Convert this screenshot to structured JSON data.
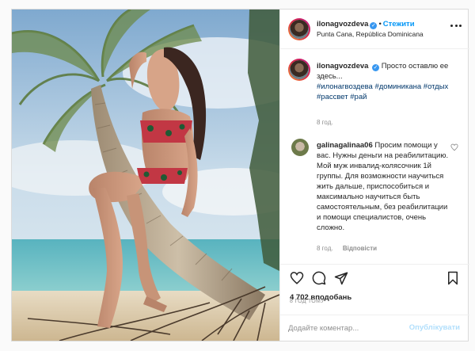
{
  "post": {
    "username": "ilonagvozdeva",
    "follow_label": "Стежити",
    "location": "Punta Cana, República Dominicana",
    "caption_text": "Просто оставлю ее здесь...",
    "hashtags": "#илонагвоздева #доминикана #отдых #рассвет #рай",
    "caption_time": "8 год.",
    "photo_alt": "woman in red floral bikini sitting on a palm tree trunk on a beach"
  },
  "comment": {
    "username": "galinagalinaa06",
    "text": "Просим помощи у вас. Нужны деньги на реабилитацию. Мой муж инвалид-колясочник 1й группы. Для возможности научиться жить дальше, приспособиться и максимально научиться быть самостоятельным, без реабилитации и помощи специалистов, очень сложно.",
    "time": "8 год.",
    "reply_label": "Відповісти"
  },
  "stats": {
    "likes": "4 702 вподобань",
    "date": "8 ГОД ТОМУ"
  },
  "composer": {
    "placeholder": "Додайте коментар...",
    "post_label": "Опублікувати"
  },
  "icons": {
    "more": "more-icon",
    "like": "heart-icon",
    "comment": "comment-icon",
    "share": "share-icon",
    "save": "bookmark-icon",
    "verified": "verified-badge-icon",
    "comment_like": "small-heart-icon"
  },
  "colors": {
    "accent": "#0095f6",
    "verified": "#3897f0",
    "hashtag": "#00376b",
    "muted": "#8e8e8e",
    "border": "#dbdbdb"
  }
}
